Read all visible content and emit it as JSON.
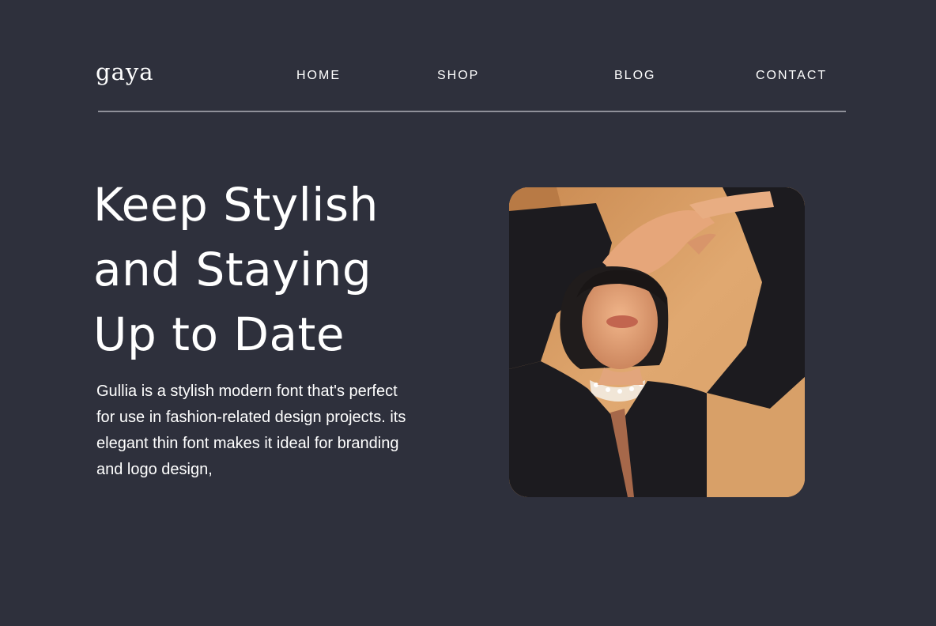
{
  "brand": {
    "logo": "gaya"
  },
  "nav": {
    "items": [
      {
        "label": "HOME"
      },
      {
        "label": "SHOP"
      },
      {
        "label": "BLOG"
      },
      {
        "label": "CONTACT"
      }
    ]
  },
  "hero": {
    "title_lines": [
      "Keep Stylish",
      "and Staying",
      "Up to Date"
    ],
    "body": "Gullia is a stylish modern font that's perfect for use in fashion-related design projects. its elegant thin font makes it ideal for branding and logo design,"
  },
  "colors": {
    "background": "#2e303c",
    "text": "#ffffff",
    "divider": "#8f9099",
    "photo_backdrop": "#d49a62",
    "jacket": "#1c1b1f"
  }
}
